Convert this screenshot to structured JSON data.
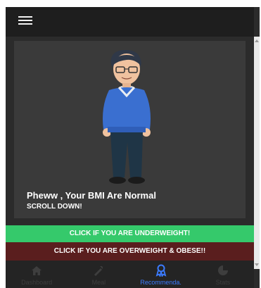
{
  "topbar": {
    "menu_icon": "hamburger-menu-icon"
  },
  "card": {
    "bmi_message": "Pheww , Your BMI Are Normal",
    "scroll_hint": "SCROLL DOWN!"
  },
  "buttons": {
    "underweight": "CLICK IF YOU ARE UNDERWEIGHT!",
    "overweight": "CLICK IF YOU ARE OVERWEIGHT & OBESE!!"
  },
  "nav": {
    "items": [
      {
        "label": "Dashboard",
        "icon": "home-icon"
      },
      {
        "label": "Meal",
        "icon": "meal-icon"
      },
      {
        "label": "Recommenda.",
        "icon": "ribbon-icon"
      },
      {
        "label": "Stats",
        "icon": "pie-chart-icon"
      }
    ],
    "active_color": "#3b7bff",
    "inactive_color": "#3e3e3e"
  },
  "colors": {
    "underweight_button": "#35c96b",
    "overweight_button": "#5a1e1e"
  }
}
